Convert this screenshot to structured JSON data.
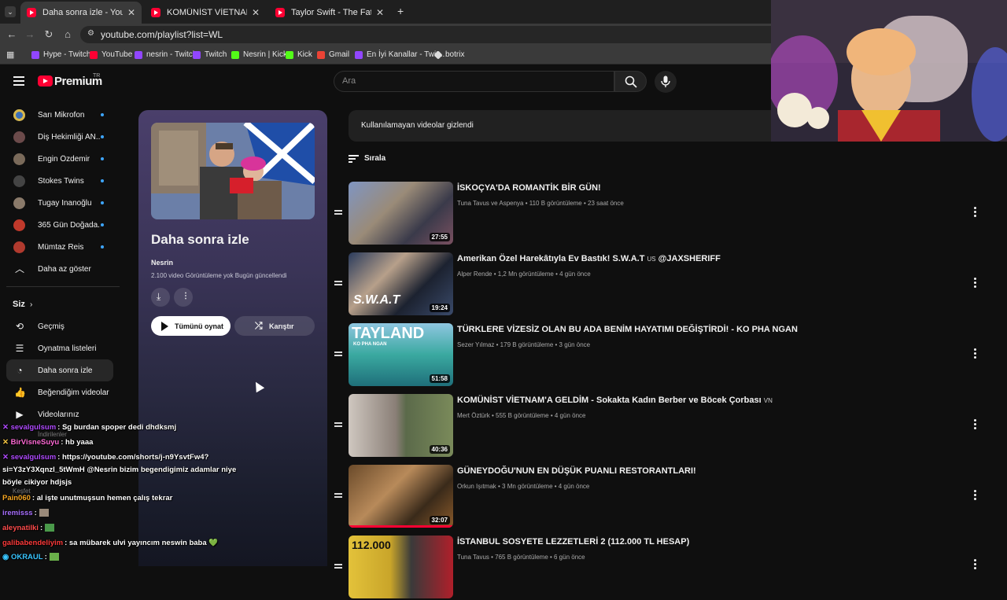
{
  "browser": {
    "tabs": [
      {
        "label": "Daha sonra izle - YouTube",
        "active": true
      },
      {
        "label": "KOMÜNİST VİETNAM'A GELDİM",
        "active": false
      },
      {
        "label": "Taylor Swift - The Fate of Ophel",
        "active": false
      }
    ],
    "new_tab_icon": "plus-icon",
    "url": "youtube.com/playlist?list=WL",
    "bookmarks": [
      {
        "label": "Hype - Twitch",
        "color": "#9146ff"
      },
      {
        "label": "YouTube",
        "color": "#ff0033"
      },
      {
        "label": "nesrin - Twitch",
        "color": "#9146ff"
      },
      {
        "label": "Twitch",
        "color": "#9146ff"
      },
      {
        "label": "Nesrin | Kick",
        "color": "#53fc18"
      },
      {
        "label": "Kick",
        "color": "#53fc18"
      },
      {
        "label": "Gmail",
        "color": "#ea4335"
      },
      {
        "label": "En İyi Kanallar - Twit...",
        "color": "#9146ff"
      },
      {
        "label": "botrix",
        "color": "#dddddd"
      }
    ]
  },
  "header": {
    "logo_text": "Premium",
    "logo_region": "TR",
    "search_placeholder": "Ara"
  },
  "sidebar": {
    "subscriptions": [
      {
        "label": "Sarı Mikrofon",
        "color": "#3b6fb6"
      },
      {
        "label": "Diş Hekimliği AN...",
        "color": "#6b4a4a"
      },
      {
        "label": "Engin Özdemir",
        "color": "#7a6a5a"
      },
      {
        "label": "Stokes Twins",
        "color": "#444444"
      },
      {
        "label": "Tugay İnanoğlu",
        "color": "#8a7a6a"
      },
      {
        "label": "365 Gün Doğada...",
        "color": "#c0392b"
      },
      {
        "label": "Mümtaz Reis",
        "color": "#b03a2e"
      }
    ],
    "show_less": "Daha az göster",
    "you_header": "Siz",
    "you_items": [
      {
        "label": "Geçmiş",
        "icon": "history-icon"
      },
      {
        "label": "Oynatma listeleri",
        "icon": "playlists-icon"
      },
      {
        "label": "Daha sonra izle",
        "icon": "watch-later-icon",
        "active": true
      },
      {
        "label": "Beğendiğim videolar",
        "icon": "thumbs-up-icon"
      },
      {
        "label": "Videolarınız",
        "icon": "your-videos-icon"
      }
    ],
    "partial_labels": [
      "İndirilenler",
      "Keşfet"
    ]
  },
  "playlist": {
    "title": "Daha sonra izle",
    "owner": "Nesrin",
    "meta": "2.100 video   Görüntüleme yok   Bugün güncellendi",
    "play_all": "Tümünü oynat",
    "shuffle": "Karıştır"
  },
  "main": {
    "hidden_notice": "Kullanılamayan videolar gizlendi",
    "sort_label": "Sırala",
    "videos": [
      {
        "title": "İSKOÇYA'DA ROMANTİK BİR GÜN!",
        "suffix": "",
        "meta": "Tuna Tavus ve Aspenya • 110 B görüntüleme • 23 saat önce",
        "duration": "27:55",
        "progress": 0.0
      },
      {
        "title": "Amerikan Özel Harekâtıyla Ev Bastık! S.W.A.T",
        "suffix": "US",
        "title_tail": " @JAXSHERIFF",
        "meta": "Alper Rende • 1,2 Mn görüntüleme • 4 gün önce",
        "duration": "19:24",
        "progress": 0.0
      },
      {
        "title": "TÜRKLERE VİZESİZ OLAN BU ADA BENİM HAYATIMI DEĞİŞTİRDİ! - KO PHA NGAN",
        "suffix": "",
        "meta": "Sezer Yılmaz • 179 B görüntüleme • 3 gün önce",
        "duration": "51:58",
        "progress": 0.0
      },
      {
        "title": "KOMÜNİST VİETNAM'A GELDİM - Sokakta Kadın Berber ve Böcek Çorbası",
        "suffix": "VN",
        "meta": "Mert Öztürk • 555 B görüntüleme • 4 gün önce",
        "duration": "40:36",
        "progress": 0.0
      },
      {
        "title": "GÜNEYDOĞU'NUN EN DÜŞÜK PUANLI RESTORANTLARI!",
        "suffix": "",
        "meta": "Orkun Işıtmak • 3 Mn görüntüleme • 4 gün önce",
        "duration": "32:07",
        "progress": 1.0
      },
      {
        "title": "İSTANBUL SOSYETE LEZZETLERİ 2 (112.000 TL HESAP)",
        "suffix": "",
        "meta": "Tuna Tavus • 765 B görüntüleme • 6 gün önce",
        "duration": "",
        "progress": 0.0
      }
    ]
  },
  "chat": [
    {
      "user": "sevalgulsum",
      "color": "#b04bff",
      "text": ": Sg burdan spoper dedi dhdksmj"
    },
    {
      "user": "BirVisneSuyu",
      "color": "#ff6ad5",
      "text": ": hb yaaa"
    },
    {
      "user": "sevalgulsum",
      "color": "#b04bff",
      "text": ": https://youtube.com/shorts/j-n9YsvtFw4?"
    },
    {
      "user": "",
      "color": "#ffffff",
      "text": "si=Y3zY3Xqnzl_5tWmH @Nesrin bizim begendigimiz adamlar niye"
    },
    {
      "user": "",
      "color": "#ffffff",
      "text": "böyle cikiyor hdjsjs"
    },
    {
      "user": "Pain060",
      "color": "#f5a623",
      "text": ": al işte unutmuşsun hemen çalış tekrar"
    },
    {
      "user": "iremisss",
      "color": "#a970ff",
      "text": ":"
    },
    {
      "user": "aleynatilki",
      "color": "#ff4d4d",
      "text": ":"
    },
    {
      "user": "galibabendeliyim",
      "color": "#ff3b3b",
      "text": ": sa mübarek ulvi yayıncım neswin baba 💚"
    },
    {
      "user": "OKRAUL",
      "color": "#39c6ff",
      "text": ":"
    }
  ],
  "colors": {
    "accent": "#ff0033",
    "link_dot": "#3ea6ff",
    "background": "#0f0f0f"
  }
}
